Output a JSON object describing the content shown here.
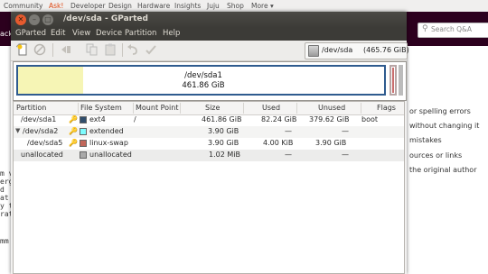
{
  "browser": {
    "nav": [
      "Community",
      "Ask!",
      "Developer",
      "Design",
      "Hardware",
      "Insights",
      "Juju",
      "Shop",
      "More ▾"
    ],
    "search_placeholder": "Search Q&A",
    "left_fragment": "ack",
    "left_text": [
      "m v",
      "erg",
      "d",
      "at",
      "y t",
      "rat",
      "mm"
    ],
    "right_text": [
      "or spelling errors",
      "without changing it",
      "mistakes",
      "ources or links",
      "the original author"
    ]
  },
  "window": {
    "title": "/dev/sda - GParted",
    "controls": {
      "close": "✕",
      "minimize": "–",
      "maximize": "□"
    }
  },
  "menu": [
    "GParted",
    "Edit",
    "View",
    "Device",
    "Partition",
    "Help"
  ],
  "toolbar": {
    "icons": [
      "new-icon",
      "delete-icon",
      "resize-icon",
      "copy-icon",
      "paste-icon",
      "undo-icon",
      "apply-icon"
    ],
    "device": "/dev/sda",
    "device_size": "(465.76 GiB)"
  },
  "partition_map": {
    "name": "/dev/sda1",
    "size": "461.86 GiB",
    "used_fraction": 0.178
  },
  "table": {
    "headers": [
      "Partition",
      "File System",
      "Mount Point",
      "Size",
      "Used",
      "Unused",
      "Flags"
    ],
    "rows": [
      {
        "partition": "/dev/sda1",
        "fs": "ext4",
        "mount": "/",
        "size": "461.86 GiB",
        "used": "82.24 GiB",
        "unused": "379.62 GiB",
        "flags": "boot",
        "color": "#314e6c"
      },
      {
        "partition": "/dev/sda2",
        "fs": "extended",
        "mount": "",
        "size": "3.90 GiB",
        "used": "—",
        "unused": "—",
        "flags": "",
        "color": "#7dfcfe"
      },
      {
        "partition": "/dev/sda5",
        "fs": "linux-swap",
        "mount": "",
        "size": "3.90 GiB",
        "used": "4.00 KiB",
        "unused": "3.90 GiB",
        "flags": "",
        "color": "#c1665a"
      },
      {
        "partition": "unallocated",
        "fs": "unallocated",
        "mount": "",
        "size": "1.02 MiB",
        "used": "—",
        "unused": "—",
        "flags": "",
        "color": "#a9a9a9"
      }
    ]
  }
}
